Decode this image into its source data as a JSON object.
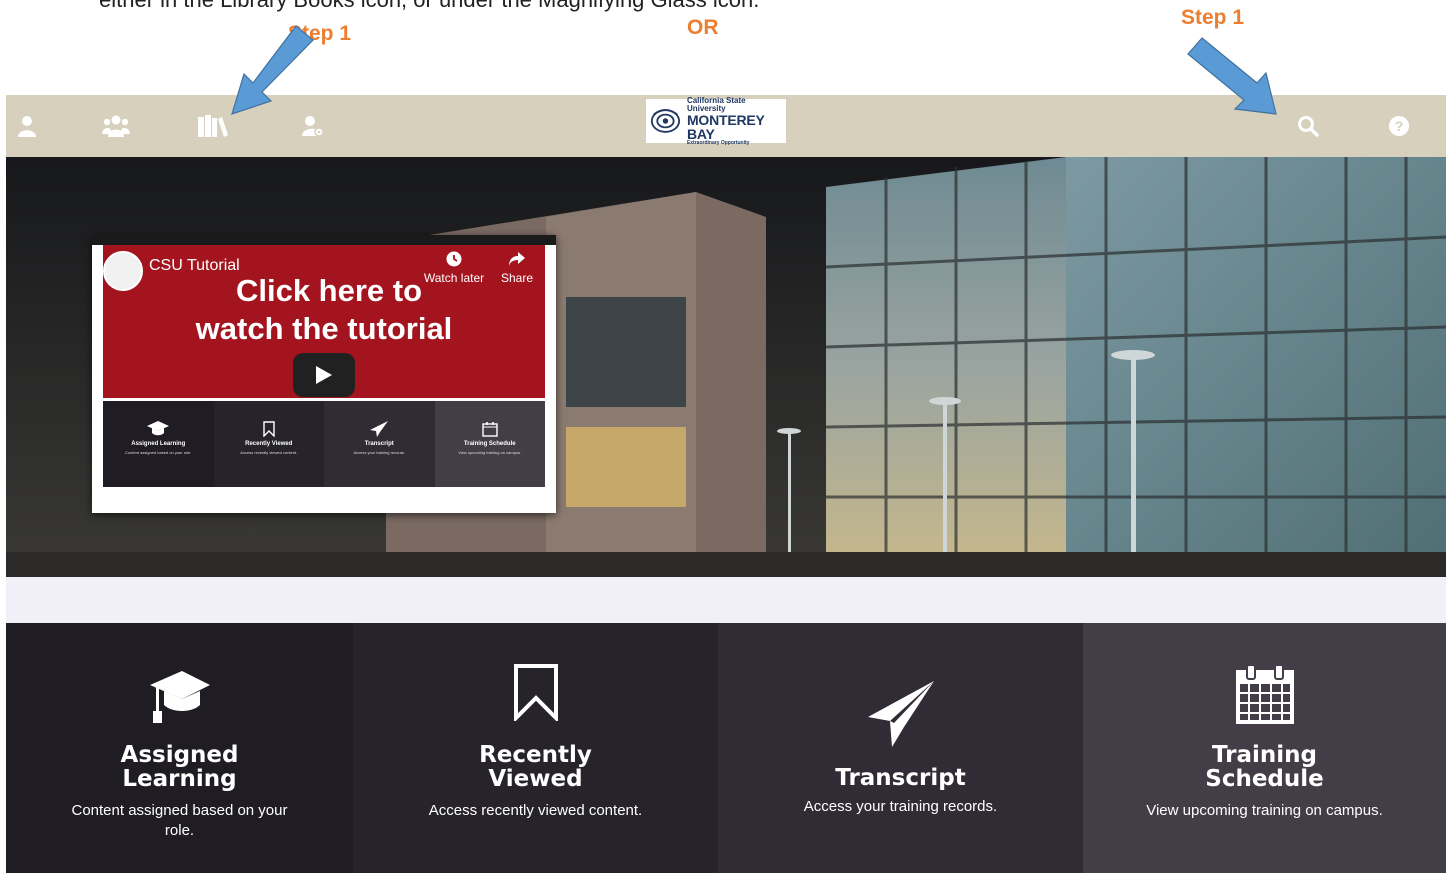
{
  "annotations": {
    "instruction_text": "either in the Library Books icon, or under the Magnifying Glass icon.",
    "step1_left": "Step 1",
    "or_label": "OR",
    "step1_right": "Step 1",
    "arrow_color": "#5b9bd5",
    "label_color": "#ed7d31"
  },
  "navbar": {
    "background": "#d6d0bd",
    "left_icons": [
      "user-icon",
      "users-group-icon",
      "library-books-icon",
      "user-settings-icon"
    ],
    "right_icons": [
      "search-icon",
      "help-icon"
    ],
    "logo": {
      "line1": "California State University",
      "line2": "MONTEREY BAY",
      "line3": "Extraordinary Opportunity"
    }
  },
  "video": {
    "channel_title": "CSU Tutorial",
    "headline_line1": "Click here to",
    "headline_line2": "watch the tutorial",
    "watch_later_label": "Watch later",
    "share_label": "Share",
    "accent": "#a3141f",
    "mini_tiles": [
      {
        "title": "Assigned Learning",
        "desc": "Content assigned based on your role."
      },
      {
        "title": "Recently Viewed",
        "desc": "Access recently viewed content."
      },
      {
        "title": "Transcript",
        "desc": "Access your training records."
      },
      {
        "title": "Training Schedule",
        "desc": "View upcoming training on campus."
      }
    ]
  },
  "tiles": [
    {
      "title_line1": "Assigned",
      "title_line2": "Learning",
      "desc": "Content assigned based on your role.",
      "icon": "graduation-cap-icon",
      "color": "#1f1c23"
    },
    {
      "title_line1": "Recently",
      "title_line2": "Viewed",
      "desc": "Access recently viewed content.",
      "icon": "bookmark-icon",
      "color": "#27232b"
    },
    {
      "title_line1": "Transcript",
      "title_line2": "",
      "desc": "Access your training records.",
      "icon": "paper-plane-icon",
      "color": "#302b34"
    },
    {
      "title_line1": "Training",
      "title_line2": "Schedule",
      "desc": "View upcoming training on campus.",
      "icon": "calendar-icon",
      "color": "#433d48"
    }
  ]
}
